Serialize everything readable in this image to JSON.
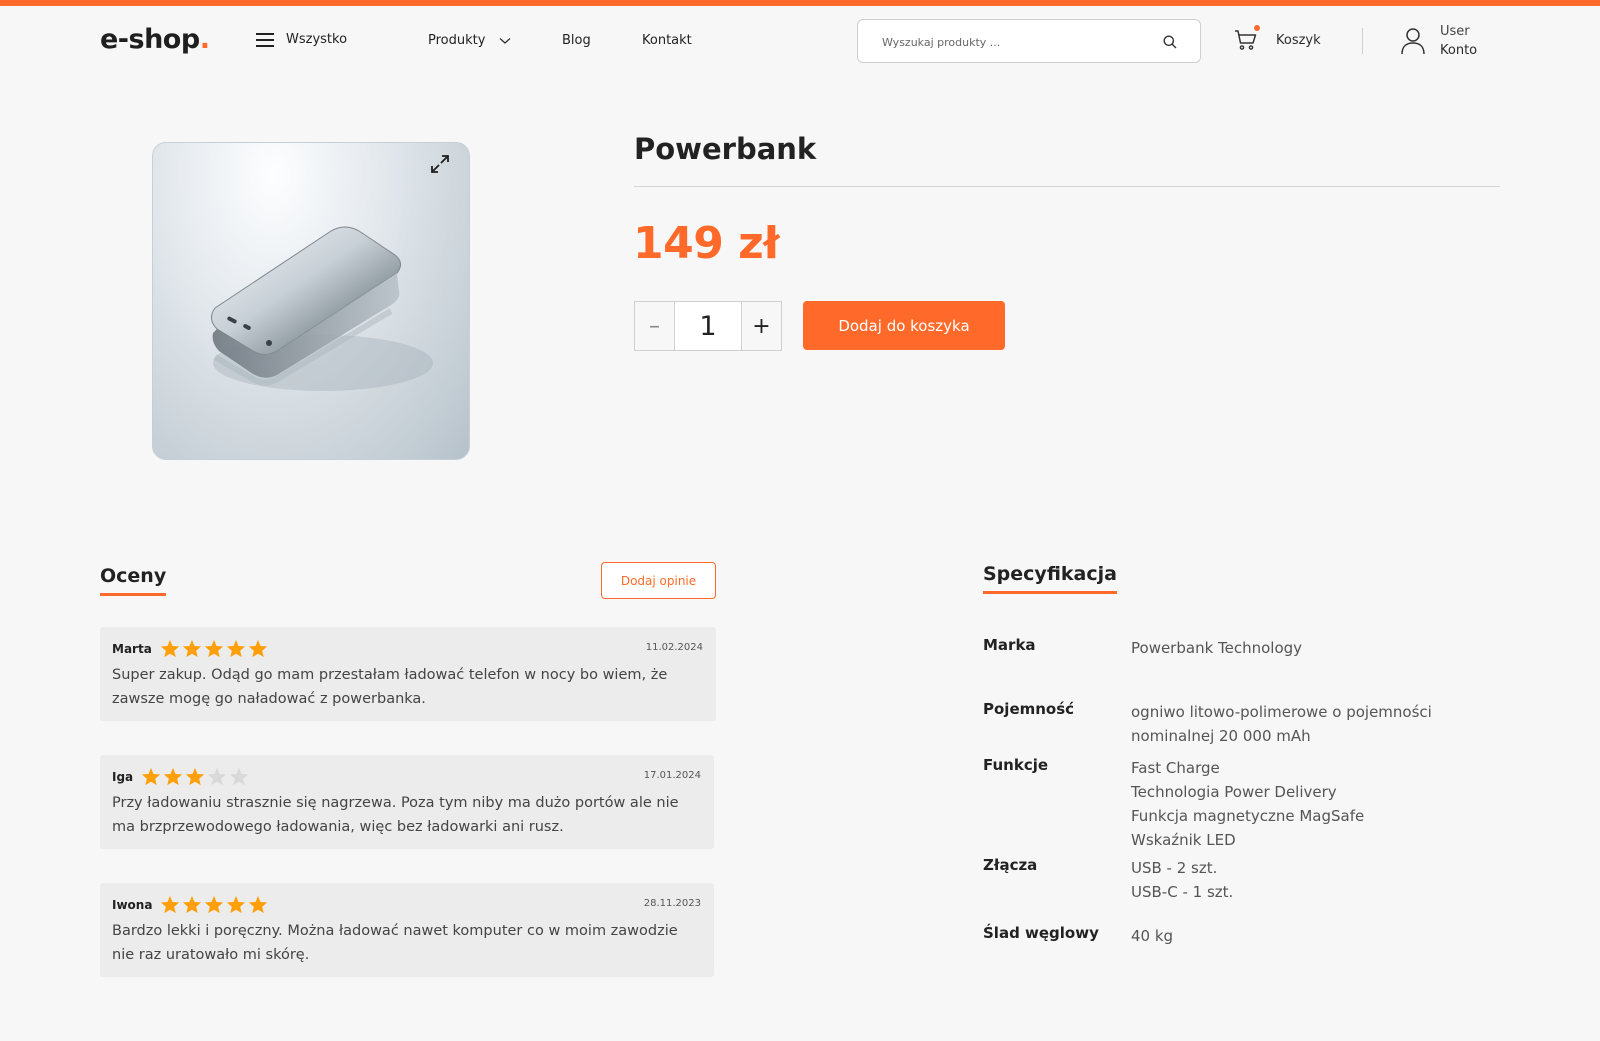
{
  "header": {
    "logo_text": "e-shop",
    "logo_dot": ".",
    "all_label": "Wszystko",
    "nav": {
      "products": "Produkty",
      "blog": "Blog",
      "contact": "Kontakt"
    },
    "search_placeholder": "Wyszukaj produkty ...",
    "cart_label": "Koszyk",
    "account_user": "User",
    "account_label": "Konto"
  },
  "product": {
    "title": "Powerbank",
    "price": "149 zł",
    "quantity": "1",
    "add_to_cart": "Dodaj do koszyka",
    "minus": "–",
    "plus": "+"
  },
  "reviews": {
    "title": "Oceny",
    "add_button": "Dodaj opinie",
    "items": [
      {
        "author": "Marta",
        "rating": 5,
        "date": "11.02.2024",
        "text": "Super zakup. Odąd go mam przestałam ładować telefon w nocy bo wiem, że zawsze mogę go naładować z powerbanka."
      },
      {
        "author": "Iga",
        "rating": 3,
        "date": "17.01.2024",
        "text": "Przy ładowaniu strasznie się nagrzewa. Poza tym niby ma dużo portów ale nie ma brzprzewodowego ładowania, więc bez ładowarki ani rusz."
      },
      {
        "author": "Iwona",
        "rating": 5,
        "date": "28.11.2023",
        "text": "Bardzo lekki i poręczny. Można ładować nawet komputer co w moim zawodzie nie raz uratowało mi skórę."
      }
    ]
  },
  "specs": {
    "title": "Specyfikacja",
    "rows": [
      {
        "label": "Marka",
        "values": [
          "Powerbank Technology"
        ]
      },
      {
        "label": "Pojemność",
        "values": [
          "ogniwo litowo-polimerowe o pojemności",
          "nominalnej 20 000 mAh"
        ]
      },
      {
        "label": "Funkcje",
        "values": [
          "Fast Charge",
          "Technologia Power Delivery",
          "Funkcja magnetyczne MagSafe",
          "Wskaźnik LED"
        ]
      },
      {
        "label": "Złącza",
        "values": [
          "USB - 2 szt.",
          "USB-C - 1 szt."
        ]
      },
      {
        "label": "Ślad węglowy",
        "values": [
          "40 kg"
        ]
      }
    ]
  },
  "colors": {
    "accent": "#ff6a2b",
    "star_on": "#ff9f0a",
    "star_off": "#d9d9d9"
  },
  "icons": [
    "hamburger-icon",
    "chevron-down-icon",
    "search-icon",
    "cart-icon",
    "user-icon",
    "expand-icon",
    "star-icon"
  ]
}
